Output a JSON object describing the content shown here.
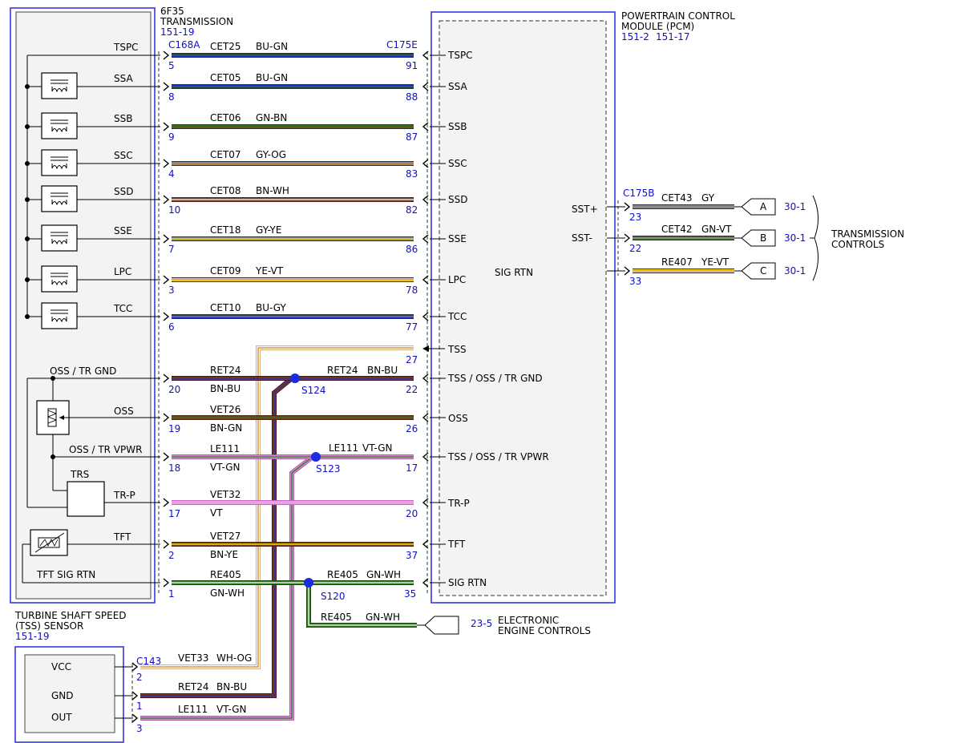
{
  "colors": {
    "border_blue": "#2a2ad8",
    "pin_blue": "#1010c8",
    "box_fill": "#f3f3f3",
    "splice_blue": "#1a2ee0",
    "BU": "#1b2ec2",
    "GN": "#2a7a1a",
    "GY": "#8a8a8a",
    "OG": "#e07a1a",
    "BN": "#7a3a1e",
    "WH": "#ffffff",
    "YE": "#f2d800",
    "VT": "#d889d8",
    "VT_dark": "#b05ab0",
    "WH_border": "#c8b48a",
    "RET_dark": "#4a1020"
  },
  "transmission": {
    "title_line1": "6F35",
    "title_line2": "TRANSMISSION",
    "ref": "151-19",
    "connector": "C168A"
  },
  "pcm": {
    "title_line1": "POWERTRAIN CONTROL",
    "title_line2": "MODULE (PCM)",
    "ref1": "151-2",
    "ref2": "151-17",
    "connector": "C175E",
    "connector_b": "C175B",
    "internal_label": "SIG RTN",
    "sst_plus": "SST+",
    "sst_minus": "SST-"
  },
  "circuits": [
    {
      "tlabel": "TSPC",
      "circuit": "CET25",
      "color": "BU-GN",
      "tpin": "5",
      "ppin": "91",
      "plabel": "TSPC"
    },
    {
      "tlabel": "SSA",
      "circuit": "CET05",
      "color": "BU-GN",
      "tpin": "8",
      "ppin": "88",
      "plabel": "SSA"
    },
    {
      "tlabel": "SSB",
      "circuit": "CET06",
      "color": "GN-BN",
      "tpin": "9",
      "ppin": "87",
      "plabel": "SSB"
    },
    {
      "tlabel": "SSC",
      "circuit": "CET07",
      "color": "GY-OG",
      "tpin": "4",
      "ppin": "83",
      "plabel": "SSC"
    },
    {
      "tlabel": "SSD",
      "circuit": "CET08",
      "color": "BN-WH",
      "tpin": "10",
      "ppin": "82",
      "plabel": "SSD"
    },
    {
      "tlabel": "SSE",
      "circuit": "CET18",
      "color": "GY-YE",
      "tpin": "7",
      "ppin": "86",
      "plabel": "SSE"
    },
    {
      "tlabel": "LPC",
      "circuit": "CET09",
      "color": "YE-VT",
      "tpin": "3",
      "ppin": "78",
      "plabel": "LPC"
    },
    {
      "tlabel": "TCC",
      "circuit": "CET10",
      "color": "BU-GY",
      "tpin": "6",
      "ppin": "77",
      "plabel": "TCC"
    }
  ],
  "lower": {
    "tss_pin": "27",
    "tss_label": "TSS",
    "ret": {
      "tlabel": "OSS / TR GND",
      "circuit": "RET24",
      "color": "BN-BU",
      "tpin": "20",
      "splice": "S124",
      "circuit2": "RET24",
      "color2": "BN-BU",
      "ppin": "22",
      "plabel": "TSS / OSS / TR GND"
    },
    "oss": {
      "tlabel": "OSS",
      "circuit": "VET26",
      "color": "BN-GN",
      "tpin": "19",
      "ppin": "26",
      "plabel": "OSS"
    },
    "le": {
      "tlabel": "OSS / TR VPWR",
      "circuit": "LE111",
      "color": "VT-GN",
      "tpin": "18",
      "splice": "S123",
      "circuit2": "LE111",
      "color2": "VT-GN",
      "ppin": "17",
      "plabel": "TSS / OSS / TR VPWR"
    },
    "trp": {
      "trs": "TRS",
      "tlabel": "TR-P",
      "circuit": "VET32",
      "color": "VT",
      "tpin": "17",
      "ppin": "20",
      "plabel": "TR-P"
    },
    "tft": {
      "tlabel": "TFT",
      "circuit": "VET27",
      "color": "BN-YE",
      "tpin": "2",
      "ppin": "37",
      "plabel": "TFT"
    },
    "sig": {
      "tlabel": "TFT SIG RTN",
      "circuit": "RE405",
      "color": "GN-WH",
      "tpin": "1",
      "splice": "S120",
      "circuit2": "RE405",
      "color2": "GN-WH",
      "ppin": "35",
      "plabel": "SIG RTN"
    }
  },
  "right_side": {
    "rows": [
      {
        "pin": "23",
        "circuit": "CET43",
        "color": "GY",
        "letter": "A",
        "ref": "30-1"
      },
      {
        "pin": "22",
        "circuit": "CET42",
        "color": "GN-VT",
        "letter": "B",
        "ref": "30-1"
      },
      {
        "pin": "33",
        "circuit": "RE407",
        "color": "YE-VT",
        "letter": "C",
        "ref": "30-1"
      }
    ],
    "group_line1": "TRANSMISSION",
    "group_line2": "CONTROLS"
  },
  "eec": {
    "circuit": "RE405",
    "color": "GN-WH",
    "ref": "23-5",
    "label_line1": "ELECTRONIC",
    "label_line2": "ENGINE CONTROLS"
  },
  "tss_sensor": {
    "title_line1": "TURBINE SHAFT SPEED",
    "title_line2": "(TSS) SENSOR",
    "ref": "151-19",
    "connector": "C143",
    "pins": [
      {
        "label": "VCC",
        "pin": "2",
        "circuit": "VET33",
        "color": "WH-OG"
      },
      {
        "label": "GND",
        "pin": "1",
        "circuit": "RET24",
        "color": "BN-BU"
      },
      {
        "label": "OUT",
        "pin": "3",
        "circuit": "LE111",
        "color": "VT-GN"
      }
    ]
  }
}
